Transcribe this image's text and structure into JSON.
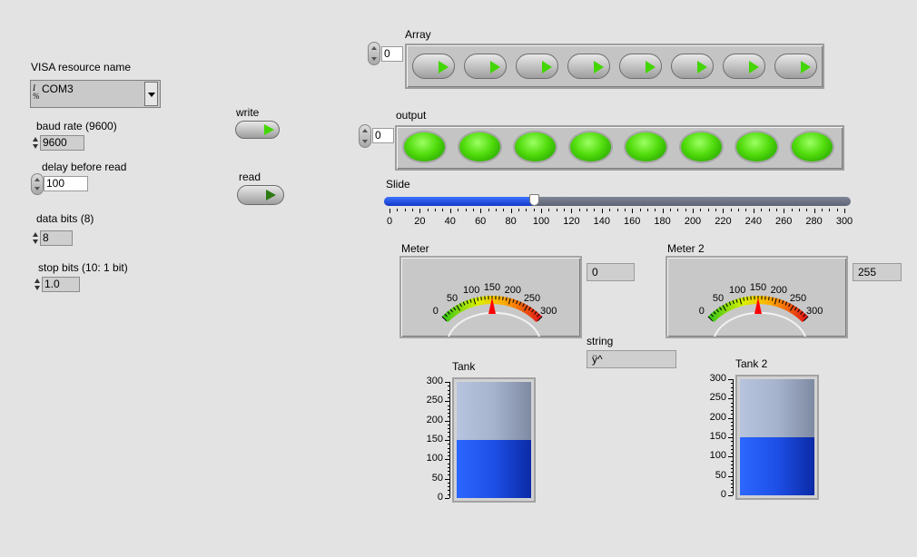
{
  "panel": {
    "visa": {
      "label": "VISA resource name",
      "value": "COM3",
      "io_glyph_top": "I",
      "io_glyph_bottom": "%"
    },
    "baud": {
      "label": "baud rate (9600)",
      "value": "9600"
    },
    "delay": {
      "label": "delay before read",
      "value": "100"
    },
    "databits": {
      "label": "data bits (8)",
      "value": "8"
    },
    "stopbits": {
      "label": "stop bits (10: 1 bit)",
      "value": "1.0"
    },
    "write": {
      "label": "write"
    },
    "read": {
      "label": "read"
    },
    "array": {
      "label": "Array",
      "index": "0",
      "count": 8
    },
    "output": {
      "label": "output",
      "index": "0",
      "count": 8
    },
    "slide": {
      "label": "Slide",
      "value": 95,
      "min": 0,
      "max": 300,
      "ticks": [
        "0",
        "20",
        "40",
        "60",
        "80",
        "100",
        "120",
        "140",
        "160",
        "180",
        "200",
        "220",
        "240",
        "260",
        "280",
        "300"
      ]
    },
    "meter1": {
      "label": "Meter",
      "value": 150,
      "display": "0",
      "scale": [
        "0",
        "50",
        "100",
        "150",
        "200",
        "250",
        "300"
      ]
    },
    "meter2": {
      "label": "Meter 2",
      "value": 150,
      "display": "255",
      "scale": [
        "0",
        "50",
        "100",
        "150",
        "200",
        "250",
        "300"
      ]
    },
    "string": {
      "label": "string",
      "value": "ÿ^"
    },
    "tank1": {
      "label": "Tank",
      "value": 150,
      "max": 300,
      "scale": [
        "300",
        "250",
        "200",
        "150",
        "100",
        "50",
        "0"
      ]
    },
    "tank2": {
      "label": "Tank 2",
      "value": 150,
      "max": 300,
      "scale": [
        "300",
        "250",
        "200",
        "150",
        "100",
        "50",
        "0"
      ]
    }
  },
  "colors": {
    "led_green": "#52dd0d",
    "slider_fill": "#1e4fe0",
    "tank_fill": "#1d4fe6",
    "meter_needle": "#ff0000"
  }
}
